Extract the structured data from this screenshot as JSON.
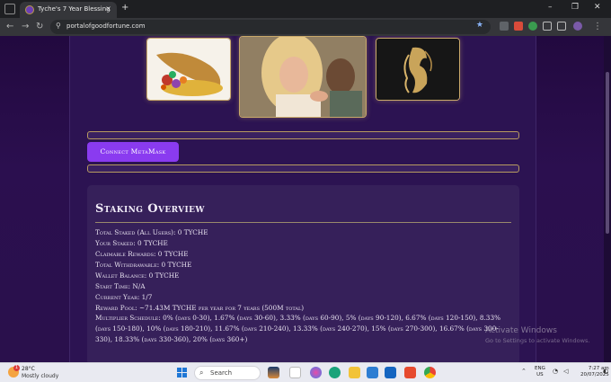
{
  "browser": {
    "tab_title": "Tyche's 7 Year Blessing",
    "tab_close": "×",
    "new_tab": "+",
    "window_controls": {
      "minimize": "–",
      "restore": "❐",
      "close": "✕"
    },
    "url": "portalofgoodfortune.com",
    "icons": [
      "tab-search-icon",
      "back-icon",
      "forward-icon",
      "reload-icon",
      "site-info-icon",
      "bookmark-star-icon",
      "extension-icons"
    ]
  },
  "page": {
    "images": [
      {
        "name": "cornucopia-image",
        "alt": "cornucopia"
      },
      {
        "name": "couple-image",
        "alt": "couple"
      },
      {
        "name": "golden-goddess-image",
        "alt": "goddess"
      }
    ],
    "connect_button": "Connect MetaMask",
    "staking": {
      "title": "Staking Overview",
      "total_staked": "Total Staked (All Users): 0 TYCHE",
      "your_staked": "Your Staked: 0 TYCHE",
      "claimable": "Claimable Rewards: 0 TYCHE",
      "withdrawable": "Total Withdrawable: 0 TYCHE",
      "wallet_balance": "Wallet Balance: 0 TYCHE",
      "start_time": "Start Time: N/A",
      "current_year": "Current Year: 1/7",
      "reward_pool": "Reward Pool: ~71.43M TYCHE per year for 7 years (500M total)",
      "multiplier_schedule": "Multiplier Schedule: 0% (days 0-30), 1.67% (days 30-60), 3.33% (days 60-90), 5% (days 90-120), 6.67% (days 120-150), 8.33% (days 150-180), 10% (days 180-210), 11.67% (days 210-240), 13.33% (days 240-270), 15% (days 270-300), 16.67% (days 300-330), 18.33% (days 330-360), 20% (days 360+)"
    },
    "watermark": {
      "line1": "Activate Windows",
      "line2": "Go to Settings to activate Windows."
    }
  },
  "taskbar": {
    "weather_temp": "28°C",
    "weather_desc": "Mostly cloudy",
    "weather_badge": "1",
    "search_placeholder": "Search",
    "language_line1": "ENG",
    "language_line2": "US",
    "time": "7:27 am",
    "date": "20/07/2025"
  },
  "colors": {
    "page_bg": "#22093f",
    "column_bg": "#2c1352",
    "accent_button": "#8a3bf0",
    "gold_border": "#c9a96a"
  }
}
